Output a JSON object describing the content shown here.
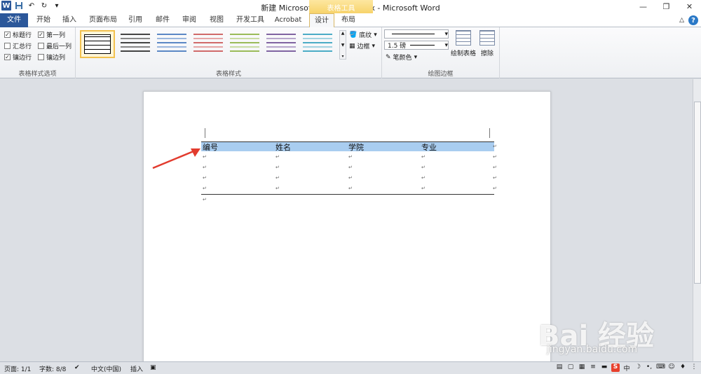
{
  "title": "新建 Microsoft Word 文档.docx - Microsoft Word",
  "contextual_tab_header": "表格工具",
  "tabs": [
    "文件",
    "开始",
    "插入",
    "页面布局",
    "引用",
    "邮件",
    "审阅",
    "视图",
    "开发工具",
    "Acrobat",
    "设计",
    "布局"
  ],
  "active_tab": "设计",
  "ribbon": {
    "table_style_options": {
      "label": "表格样式选项",
      "options": [
        {
          "label": "标题行",
          "checked": true
        },
        {
          "label": "第一列",
          "checked": true
        },
        {
          "label": "汇总行",
          "checked": false
        },
        {
          "label": "最后一列",
          "checked": false
        },
        {
          "label": "镶边行",
          "checked": true
        },
        {
          "label": "镶边列",
          "checked": false
        }
      ]
    },
    "table_styles": {
      "label": "表格样式",
      "shading": "底纹",
      "borders": "边框",
      "thumb_colors": [
        "#000000",
        "#444444",
        "#5b87c5",
        "#d06a6a",
        "#9bbb59",
        "#8064a2",
        "#4bacc6"
      ]
    },
    "draw_borders": {
      "label": "绘图边框",
      "pen_weight": "1.5 磅",
      "pen_color": "笔颜色",
      "draw_table": "绘制表格",
      "eraser": "擦除"
    }
  },
  "document": {
    "table_headers": [
      "编号",
      "姓名",
      "学院",
      "专业"
    ],
    "header_fill": "#a9cdf0",
    "body_rows": 4,
    "paragraph_mark": "↵"
  },
  "statusbar": {
    "page": "页面: 1/1",
    "words": "字数: 8/8",
    "language": "中文(中国)",
    "mode": "插入",
    "ime": "S",
    "ime_lang": "中"
  },
  "watermark": {
    "brand": "Bai 经验",
    "url": "jingyan.baidu.com"
  }
}
